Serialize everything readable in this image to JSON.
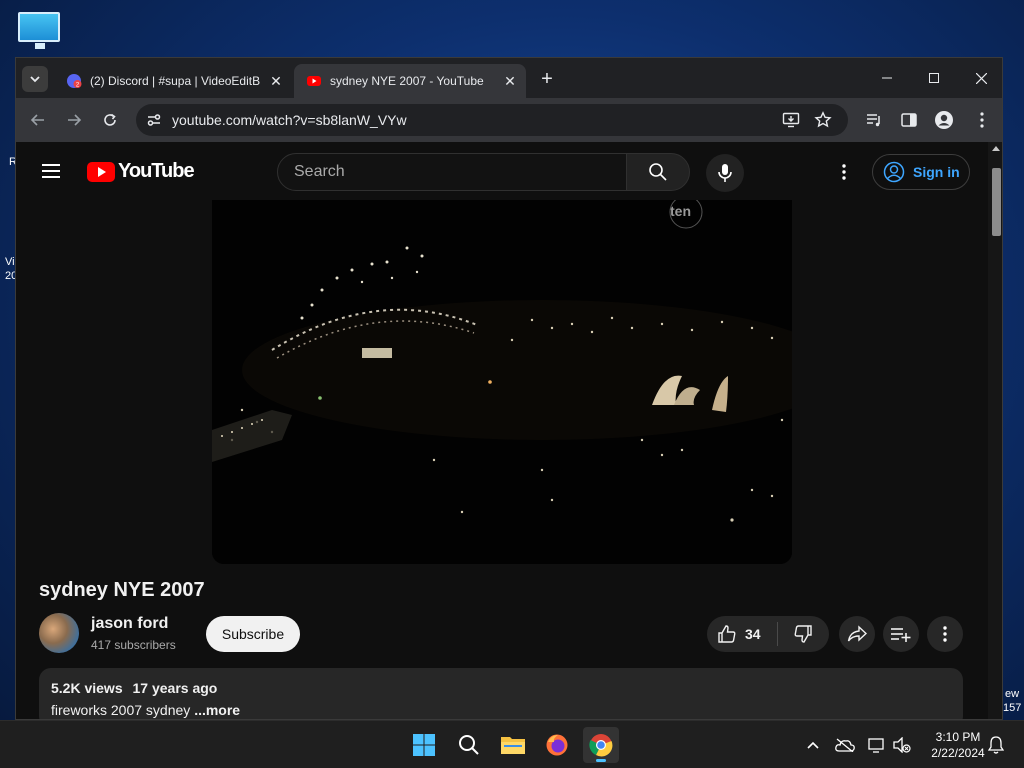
{
  "desktop": {
    "edge_left_1": "R",
    "edge_left_2": "Vi",
    "edge_left_3": "20",
    "edge_right_1": "ew",
    "edge_right_2": "157"
  },
  "browser": {
    "tabs": [
      {
        "title": "(2) Discord | #supa | VideoEditB",
        "favicon": "discord-icon",
        "badge": "2"
      },
      {
        "title": "sydney NYE 2007 - YouTube",
        "favicon": "youtube-icon"
      }
    ],
    "url": "youtube.com/watch?v=sb8lanW_VYw"
  },
  "youtube": {
    "logo_text": "YouTube",
    "search_placeholder": "Search",
    "signin_label": "Sign in",
    "video": {
      "watermark": "ten",
      "title": "sydney NYE 2007",
      "channel": "jason ford",
      "subscribers": "417 subscribers",
      "subscribe_label": "Subscribe",
      "likes": "34",
      "views": "5.2K views",
      "age": "17 years ago",
      "description": "fireworks 2007 sydney",
      "more_label": "...more"
    }
  },
  "taskbar": {
    "time": "3:10 PM",
    "date": "2/22/2024",
    "accent": "#4cc2ff"
  },
  "colors": {
    "youtube_red": "#ff0000",
    "link_blue": "#3ea6ff",
    "page_bg": "#0f0f0f"
  }
}
